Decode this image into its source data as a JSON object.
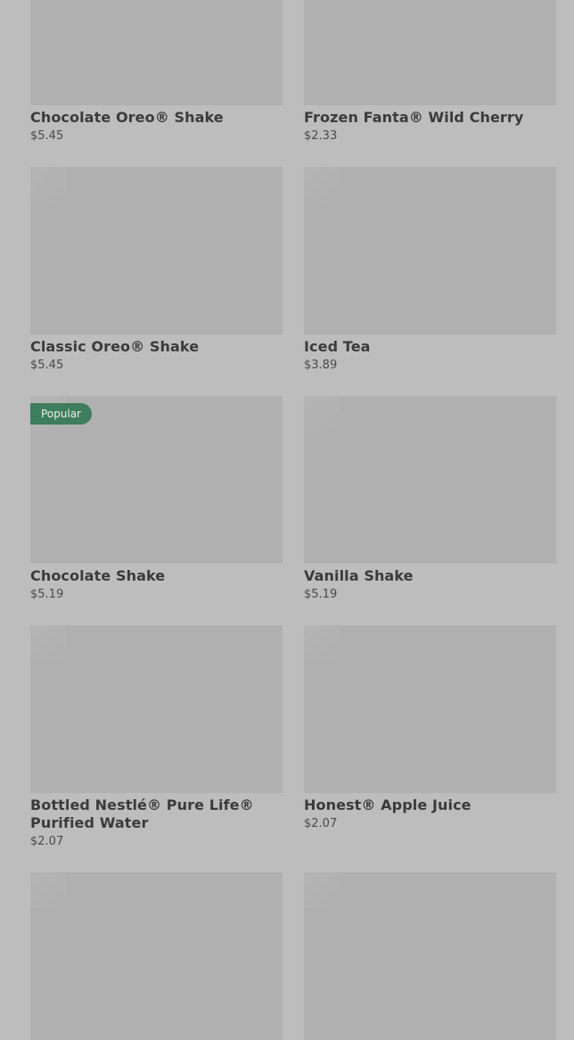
{
  "menu": {
    "items": [
      {
        "name": "",
        "price": "",
        "badge": ""
      },
      {
        "name": "",
        "price": "",
        "badge": ""
      },
      {
        "name": "Chocolate Oreo® Shake",
        "price": "$5.45",
        "badge": ""
      },
      {
        "name": "Frozen Fanta® Wild Cherry",
        "price": "$2.33",
        "badge": ""
      },
      {
        "name": "Classic Oreo® Shake",
        "price": "$5.45",
        "badge": ""
      },
      {
        "name": "Iced Tea",
        "price": "$3.89",
        "badge": ""
      },
      {
        "name": "Chocolate Shake",
        "price": "$5.19",
        "badge": "Popular"
      },
      {
        "name": "Vanilla Shake",
        "price": "$5.19",
        "badge": ""
      },
      {
        "name": "Bottled Nestlé® Pure Life® Purified Water",
        "price": "$2.07",
        "badge": ""
      },
      {
        "name": "Honest® Apple Juice",
        "price": "$2.07",
        "badge": ""
      },
      {
        "name": "",
        "price": "",
        "badge": ""
      },
      {
        "name": "",
        "price": "",
        "badge": ""
      }
    ]
  },
  "colors": {
    "background": "#bdbdbd",
    "thumbnail": "#b0b0b0",
    "badge": "#3e7d5d"
  }
}
